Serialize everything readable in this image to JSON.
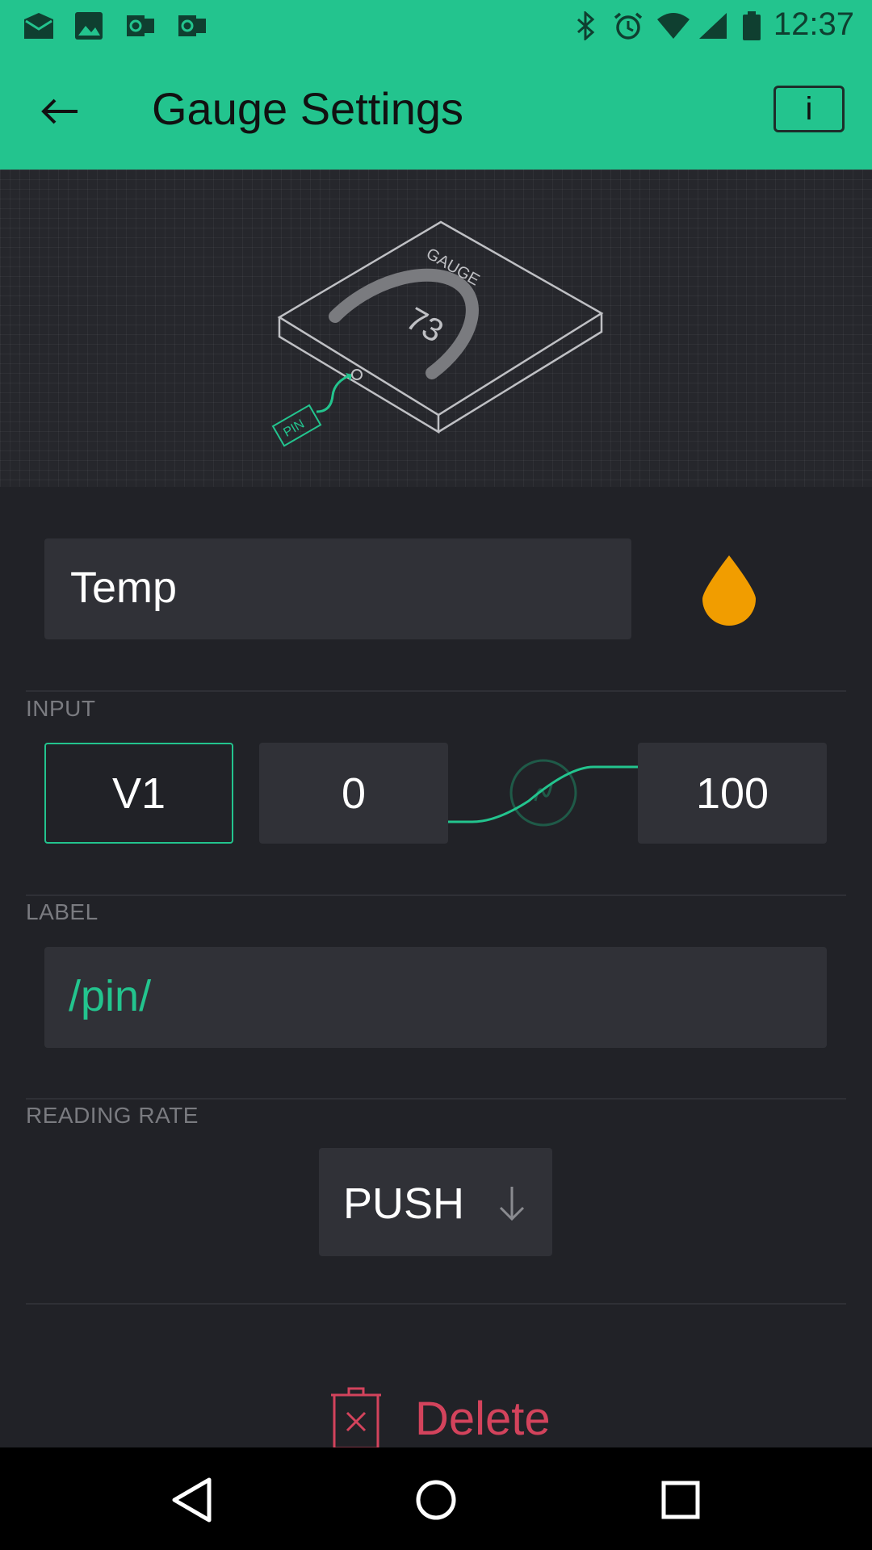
{
  "status_bar": {
    "time": "12:37",
    "left_icons": [
      "mail-icon",
      "image-icon",
      "outlook-icon",
      "outlook-icon"
    ],
    "right_icons": [
      "bluetooth-icon",
      "alarm-icon",
      "wifi-icon",
      "signal-icon",
      "battery-icon"
    ]
  },
  "app_bar": {
    "title": "Gauge Settings",
    "back_icon": "arrow-left-icon",
    "info_label": "i"
  },
  "preview": {
    "widget_label": "GAUGE",
    "gauge_value": "73",
    "pin_tag": "PIN"
  },
  "name": {
    "value": "Temp",
    "color": "#f19d00"
  },
  "input": {
    "section_label": "INPUT",
    "pin": "V1",
    "min": "0",
    "max": "100"
  },
  "label": {
    "section_label": "LABEL",
    "value": "/pin/"
  },
  "reading_rate": {
    "section_label": "READING RATE",
    "value": "PUSH"
  },
  "delete": {
    "label": "Delete"
  },
  "colors": {
    "accent": "#23c48e",
    "background": "#212227",
    "field": "#303137",
    "danger": "#d3435c"
  }
}
